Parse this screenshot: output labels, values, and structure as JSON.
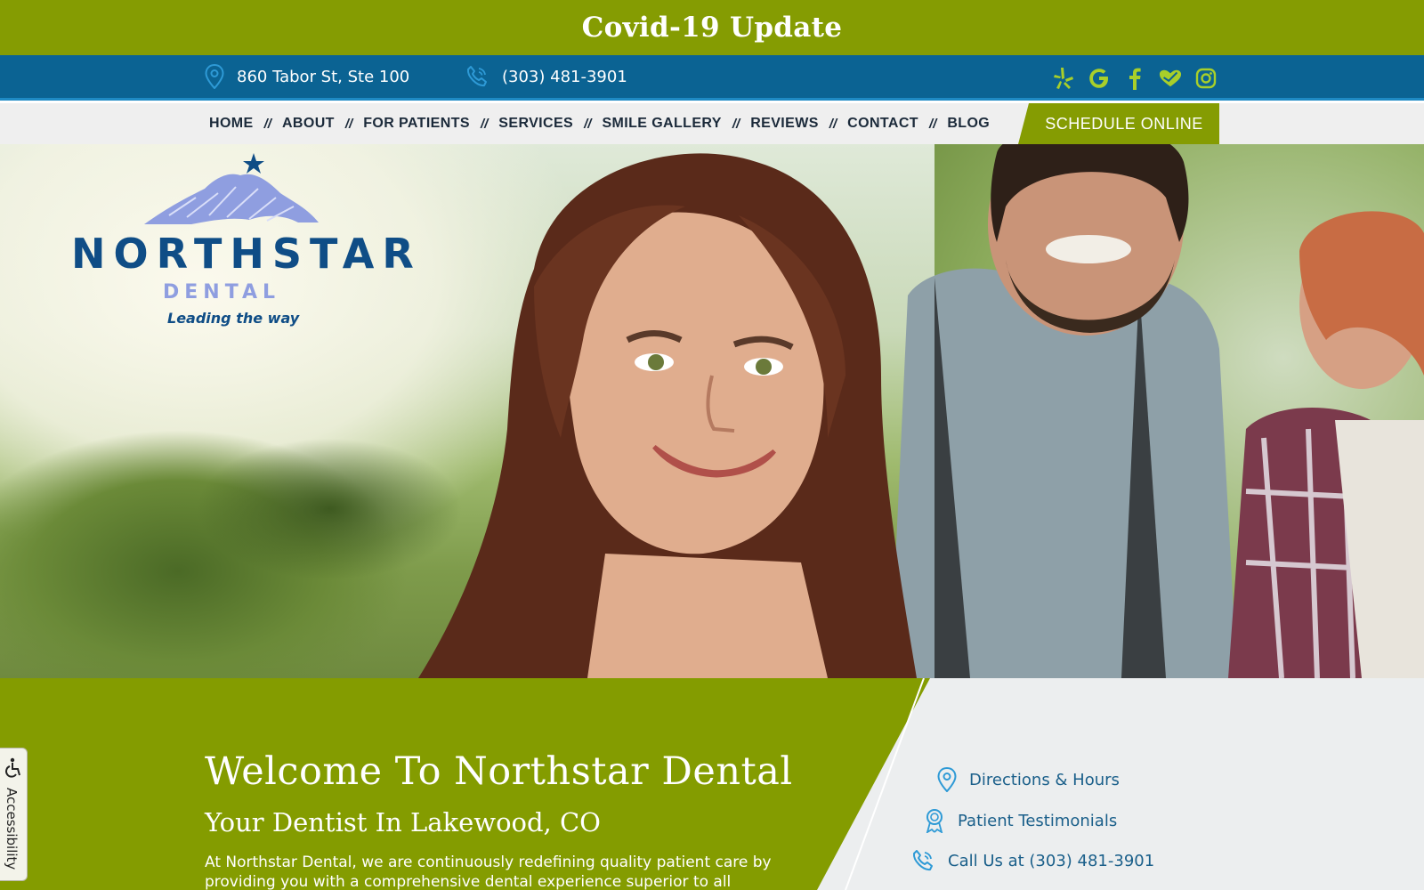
{
  "banner": {
    "text": "Covid-19 Update"
  },
  "contact": {
    "address": "860 Tabor St, Ste 100",
    "phone": "(303) 481-3901",
    "social_icons": [
      "yelp-icon",
      "google-icon",
      "facebook-icon",
      "healthgrades-icon",
      "instagram-icon"
    ]
  },
  "nav": {
    "items": [
      "HOME",
      "ABOUT",
      "FOR PATIENTS",
      "SERVICES",
      "SMILE GALLERY",
      "REVIEWS",
      "CONTACT",
      "BLOG"
    ],
    "separator": "//",
    "schedule": "SCHEDULE ONLINE"
  },
  "logo": {
    "name": "NORTHSTAR",
    "sub": "DENTAL",
    "tagline": "Leading the way"
  },
  "welcome": {
    "title": "Welcome To Northstar Dental",
    "subtitle": "Your Dentist In Lakewood, CO",
    "body": "At Northstar Dental, we are continuously redefining quality patient care by providing you with a comprehensive dental experience superior to all"
  },
  "quick_links": {
    "directions": "Directions & Hours",
    "testimonials": "Patient Testimonials",
    "call": "Call Us at (303) 481-3901"
  },
  "accessibility": {
    "label": "Accessibility"
  },
  "colors": {
    "green": "#859c02",
    "blue": "#0b6393",
    "navy": "#0f4d86",
    "light_green": "#a8cf2a"
  }
}
